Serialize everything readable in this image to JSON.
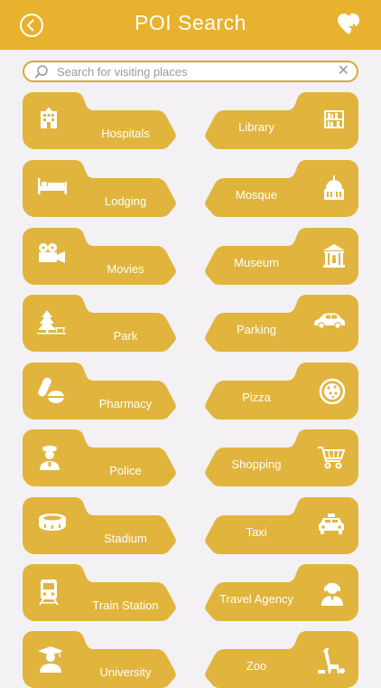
{
  "header": {
    "title": "POI Search"
  },
  "search": {
    "placeholder": "Search for visiting places"
  },
  "colors": {
    "accent": "#e8b12e",
    "tile": "#e0b43d",
    "background": "#f3f1f4"
  },
  "categories": [
    {
      "label": "Hospitals",
      "icon": "hospital-icon"
    },
    {
      "label": "Library",
      "icon": "library-icon"
    },
    {
      "label": "Lodging",
      "icon": "bed-icon"
    },
    {
      "label": "Mosque",
      "icon": "mosque-icon"
    },
    {
      "label": "Movies",
      "icon": "film-camera-icon"
    },
    {
      "label": "Museum",
      "icon": "museum-icon"
    },
    {
      "label": "Park",
      "icon": "tree-icon"
    },
    {
      "label": "Parking",
      "icon": "car-icon"
    },
    {
      "label": "Pharmacy",
      "icon": "pills-icon"
    },
    {
      "label": "Pizza",
      "icon": "pizza-icon"
    },
    {
      "label": "Police",
      "icon": "policeman-icon"
    },
    {
      "label": "Shopping",
      "icon": "shopping-cart-icon"
    },
    {
      "label": "Stadium",
      "icon": "stadium-icon"
    },
    {
      "label": "Taxi",
      "icon": "taxi-icon"
    },
    {
      "label": "Train Station",
      "icon": "train-icon"
    },
    {
      "label": "Travel Agency",
      "icon": "travel-agent-icon"
    },
    {
      "label": "University",
      "icon": "graduate-icon"
    },
    {
      "label": "Zoo",
      "icon": "giraffe-icon"
    }
  ]
}
